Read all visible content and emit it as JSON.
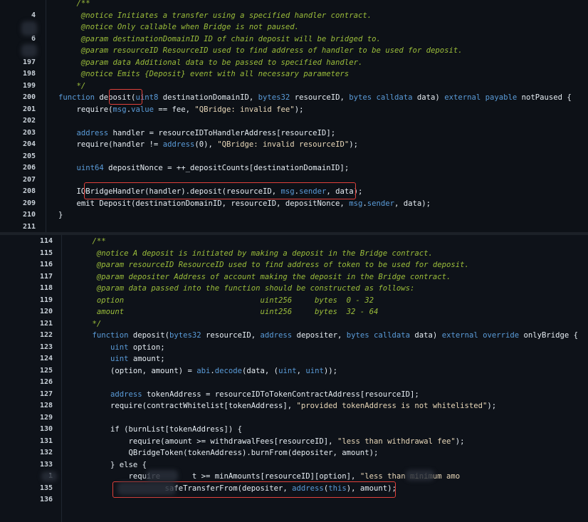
{
  "panel_top": {
    "lines": [
      {
        "n": "",
        "segs": [
          [
            "comment",
            "    /**"
          ]
        ]
      },
      {
        "n": "4",
        "segs": [
          [
            "comment",
            "     @notice Initiates a transfer using a specified handler contract."
          ]
        ]
      },
      {
        "n": "",
        "segs": [
          [
            "comment",
            "     @notice Only callable when Bridge is not paused."
          ]
        ]
      },
      {
        "n": "6",
        "segs": [
          [
            "comment",
            "     @param destinationDomainID ID of chain deposit will be bridged to."
          ]
        ]
      },
      {
        "n": "",
        "segs": [
          [
            "comment",
            "     @param resourceID ResourceID used to find address of handler to be used for deposit."
          ]
        ]
      },
      {
        "n": "197",
        "segs": [
          [
            "comment",
            "     @param data Additional data to be passed to specified handler."
          ]
        ]
      },
      {
        "n": "198",
        "segs": [
          [
            "comment",
            "     @notice Emits {Deposit} event with all necessary parameters"
          ]
        ]
      },
      {
        "n": "199",
        "segs": [
          [
            "comment",
            "    */"
          ]
        ]
      },
      {
        "n": "200",
        "segs": [
          [
            "keyword",
            "function "
          ],
          [
            "plain",
            "deposit("
          ],
          [
            "keyword",
            "uint8"
          ],
          [
            "plain",
            " destinationDomainID, "
          ],
          [
            "keyword",
            "bytes32"
          ],
          [
            "plain",
            " resourceID, "
          ],
          [
            "keyword",
            "bytes calldata"
          ],
          [
            "plain",
            " data) "
          ],
          [
            "keyword",
            "external payable"
          ],
          [
            "plain",
            " notPaused {"
          ]
        ]
      },
      {
        "n": "201",
        "segs": [
          [
            "plain",
            "    require("
          ],
          [
            "keyword",
            "msg"
          ],
          [
            "plain",
            "."
          ],
          [
            "keyword",
            "value"
          ],
          [
            "plain",
            " == fee, "
          ],
          [
            "string",
            "\"QBridge: invalid fee\""
          ],
          [
            "plain",
            ");"
          ]
        ]
      },
      {
        "n": "202",
        "segs": []
      },
      {
        "n": "203",
        "segs": [
          [
            "keyword",
            "    address"
          ],
          [
            "plain",
            " handler = resourceIDToHandlerAddress[resourceID];"
          ]
        ]
      },
      {
        "n": "204",
        "segs": [
          [
            "plain",
            "    require(handler != "
          ],
          [
            "keyword",
            "address"
          ],
          [
            "plain",
            "(0), "
          ],
          [
            "string",
            "\"QBridge: invalid resourceID\""
          ],
          [
            "plain",
            ");"
          ]
        ]
      },
      {
        "n": "205",
        "segs": []
      },
      {
        "n": "206",
        "segs": [
          [
            "keyword",
            "    uint64"
          ],
          [
            "plain",
            " depositNonce = ++_depositCounts[destinationDomainID];"
          ]
        ]
      },
      {
        "n": "207",
        "segs": []
      },
      {
        "n": "208",
        "segs": [
          [
            "plain",
            "    IQBridgeHandler(handler).deposit(resourceID, "
          ],
          [
            "keyword",
            "msg"
          ],
          [
            "plain",
            "."
          ],
          [
            "keyword",
            "sender"
          ],
          [
            "plain",
            ", data);"
          ]
        ]
      },
      {
        "n": "209",
        "segs": [
          [
            "plain",
            "    emit Deposit(destinationDomainID, resourceID, depositNonce, "
          ],
          [
            "keyword",
            "msg"
          ],
          [
            "plain",
            "."
          ],
          [
            "keyword",
            "sender"
          ],
          [
            "plain",
            ", data);"
          ]
        ]
      },
      {
        "n": "210",
        "segs": [
          [
            "plain",
            "}"
          ]
        ]
      },
      {
        "n": "211",
        "segs": []
      }
    ]
  },
  "panel_bottom": {
    "lines": [
      {
        "n": "114",
        "segs": [
          [
            "comment",
            "    /**"
          ]
        ]
      },
      {
        "n": "115",
        "segs": [
          [
            "comment",
            "     @notice A deposit is initiated by making a deposit in the Bridge contract."
          ]
        ]
      },
      {
        "n": "116",
        "segs": [
          [
            "comment",
            "     @param resourceID ResourceID used to find address of token to be used for deposit."
          ]
        ]
      },
      {
        "n": "117",
        "segs": [
          [
            "comment",
            "     @param depositer Address of account making the deposit in the Bridge contract."
          ]
        ]
      },
      {
        "n": "118",
        "segs": [
          [
            "comment",
            "     @param data passed into the function should be constructed as follows:"
          ]
        ]
      },
      {
        "n": "119",
        "segs": [
          [
            "comment",
            "     option                              uint256     bytes  0 - 32"
          ]
        ]
      },
      {
        "n": "120",
        "segs": [
          [
            "comment",
            "     amount                              uint256     bytes  32 - 64"
          ]
        ]
      },
      {
        "n": "121",
        "segs": [
          [
            "comment",
            "    */"
          ]
        ]
      },
      {
        "n": "122",
        "segs": [
          [
            "keyword",
            "    function "
          ],
          [
            "plain",
            "deposit("
          ],
          [
            "keyword",
            "bytes32"
          ],
          [
            "plain",
            " resourceID, "
          ],
          [
            "keyword",
            "address"
          ],
          [
            "plain",
            " depositer, "
          ],
          [
            "keyword",
            "bytes calldata"
          ],
          [
            "plain",
            " data) "
          ],
          [
            "keyword",
            "external override"
          ],
          [
            "plain",
            " onlyBridge {"
          ]
        ]
      },
      {
        "n": "123",
        "segs": [
          [
            "keyword",
            "        uint"
          ],
          [
            "plain",
            " option;"
          ]
        ]
      },
      {
        "n": "124",
        "segs": [
          [
            "keyword",
            "        uint"
          ],
          [
            "plain",
            " amount;"
          ]
        ]
      },
      {
        "n": "125",
        "segs": [
          [
            "plain",
            "        (option, amount) = "
          ],
          [
            "keyword",
            "abi"
          ],
          [
            "plain",
            "."
          ],
          [
            "keyword",
            "decode"
          ],
          [
            "plain",
            "(data, ("
          ],
          [
            "keyword",
            "uint"
          ],
          [
            "plain",
            ", "
          ],
          [
            "keyword",
            "uint"
          ],
          [
            "plain",
            "));"
          ]
        ]
      },
      {
        "n": "126",
        "segs": []
      },
      {
        "n": "127",
        "segs": [
          [
            "keyword",
            "        address"
          ],
          [
            "plain",
            " tokenAddress = resourceIDToTokenContractAddress[resourceID];"
          ]
        ]
      },
      {
        "n": "128",
        "segs": [
          [
            "plain",
            "        require(contractWhitelist[tokenAddress], "
          ],
          [
            "string",
            "\"provided tokenAddress is not whitelisted\""
          ],
          [
            "plain",
            ");"
          ]
        ]
      },
      {
        "n": "129",
        "segs": []
      },
      {
        "n": "130",
        "segs": [
          [
            "plain",
            "        if (burnList[tokenAddress]) {"
          ]
        ]
      },
      {
        "n": "131",
        "segs": [
          [
            "plain",
            "            require(amount >= withdrawalFees[resourceID], "
          ],
          [
            "string",
            "\"less than withdrawal fee\""
          ],
          [
            "plain",
            ");"
          ]
        ]
      },
      {
        "n": "132",
        "segs": [
          [
            "plain",
            "            QBridgeToken(tokenAddress).burnFrom(depositer, amount);"
          ]
        ]
      },
      {
        "n": "133",
        "segs": [
          [
            "plain",
            "        } else {"
          ]
        ]
      },
      {
        "n": "1",
        "segs": [
          [
            "plain",
            "            require       t >= minAmounts[resourceID][option], "
          ],
          [
            "string",
            "\"less than minimum amo"
          ]
        ]
      },
      {
        "n": "135",
        "segs": [
          [
            "plain",
            "                    safeTransferFrom(depositer, "
          ],
          [
            "keyword",
            "address"
          ],
          [
            "plain",
            "("
          ],
          [
            "keyword",
            "this"
          ],
          [
            "plain",
            "), amount);"
          ]
        ]
      },
      {
        "n": "136",
        "segs": []
      }
    ]
  }
}
